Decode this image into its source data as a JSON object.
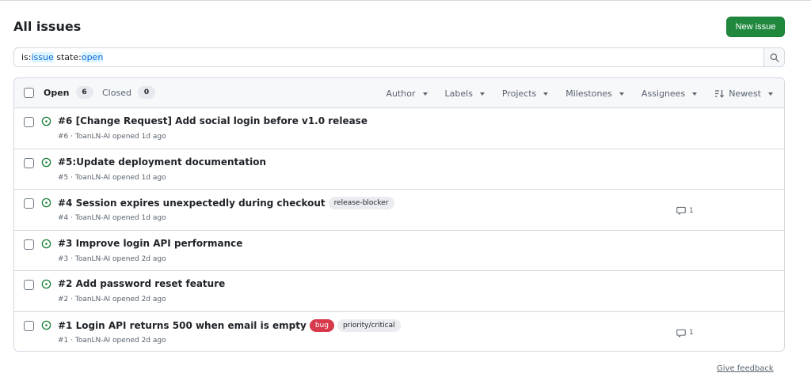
{
  "header": {
    "title": "All issues",
    "new_issue_label": "New issue"
  },
  "search": {
    "tokens": [
      {
        "key": "is:",
        "value": "issue"
      },
      {
        "key": " state:",
        "value": "open"
      }
    ]
  },
  "list_header": {
    "open_label": "Open",
    "open_count": "6",
    "closed_label": "Closed",
    "closed_count": "0",
    "filters": [
      "Author",
      "Labels",
      "Projects",
      "Milestones",
      "Assignees"
    ],
    "sort_label": "Newest"
  },
  "issues": [
    {
      "title": "#6 [Change Request] Add social login before v1.0 release",
      "meta": "#6 · ToanLN-AI opened 1d ago",
      "labels": [],
      "comments": ""
    },
    {
      "title": "#5:Update deployment documentation",
      "meta": "#5 · ToanLN-AI opened 1d ago",
      "labels": [],
      "comments": ""
    },
    {
      "title": "#4 Session expires unexpectedly during checkout",
      "meta": "#4 · ToanLN-AI opened 1d ago",
      "labels": [
        {
          "name": "release-blocker",
          "bg": "#eaecef",
          "fg": "#1f2328"
        }
      ],
      "comments": "1"
    },
    {
      "title": "#3 Improve login API performance",
      "meta": "#3 · ToanLN-AI opened 2d ago",
      "labels": [],
      "comments": ""
    },
    {
      "title": "#2 Add password reset feature",
      "meta": "#2 · ToanLN-AI opened 2d ago",
      "labels": [],
      "comments": ""
    },
    {
      "title": "#1 Login API returns 500 when email is empty",
      "meta": "#1 · ToanLN-AI opened 2d ago",
      "labels": [
        {
          "name": "bug",
          "bg": "#d73a4a",
          "fg": "#ffffff"
        },
        {
          "name": "priority/critical",
          "bg": "#eaecef",
          "fg": "#1f2328"
        }
      ],
      "comments": "1"
    }
  ],
  "footer": {
    "feedback_label": "Give feedback"
  },
  "colors": {
    "primary_button": "#1f883d",
    "open_icon": "#1a7f37",
    "link": "#0969da"
  },
  "icons": {
    "search": "search-icon",
    "open_issue": "issue-opened-icon",
    "comment": "comment-icon",
    "sort": "sort-desc-icon"
  }
}
